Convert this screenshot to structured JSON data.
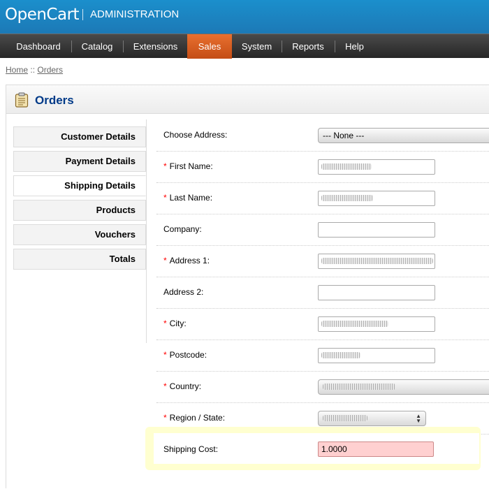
{
  "header": {
    "logo": "OpenCart",
    "title": "ADMINISTRATION"
  },
  "menu": [
    {
      "label": "Dashboard",
      "active": false
    },
    {
      "label": "Catalog",
      "active": false
    },
    {
      "label": "Extensions",
      "active": false
    },
    {
      "label": "Sales",
      "active": true
    },
    {
      "label": "System",
      "active": false
    },
    {
      "label": "Reports",
      "active": false
    },
    {
      "label": "Help",
      "active": false
    }
  ],
  "breadcrumb": {
    "home": "Home",
    "separator": "::",
    "current": "Orders"
  },
  "page": {
    "title": "Orders",
    "icon": "clipboard-icon"
  },
  "tabs": [
    {
      "label": "Customer Details",
      "selected": false
    },
    {
      "label": "Payment Details",
      "selected": false
    },
    {
      "label": "Shipping Details",
      "selected": true
    },
    {
      "label": "Products",
      "selected": false
    },
    {
      "label": "Vouchers",
      "selected": false
    },
    {
      "label": "Totals",
      "selected": false
    }
  ],
  "form": {
    "choose_address": {
      "label": "Choose Address:",
      "value": "--- None ---"
    },
    "first_name": {
      "label": "First Name:",
      "required": true,
      "value": ""
    },
    "last_name": {
      "label": "Last Name:",
      "required": true,
      "value": ""
    },
    "company": {
      "label": "Company:",
      "required": false,
      "value": ""
    },
    "address_1": {
      "label": "Address 1:",
      "required": true,
      "value": ""
    },
    "address_2": {
      "label": "Address 2:",
      "required": false,
      "value": ""
    },
    "city": {
      "label": "City:",
      "required": true,
      "value": ""
    },
    "postcode": {
      "label": "Postcode:",
      "required": true,
      "value": ""
    },
    "country": {
      "label": "Country:",
      "required": true,
      "value": ""
    },
    "region": {
      "label": "Region / State:",
      "required": true,
      "value": ""
    },
    "shipping_cost": {
      "label": "Shipping Cost:",
      "value": "1.0000"
    }
  },
  "colors": {
    "header": "#1c84c0",
    "menu": "#333333",
    "active_tab": "#d85e22",
    "title": "#003a88",
    "highlight": "#ffffc8",
    "cost_field": "#ffd0d0"
  }
}
